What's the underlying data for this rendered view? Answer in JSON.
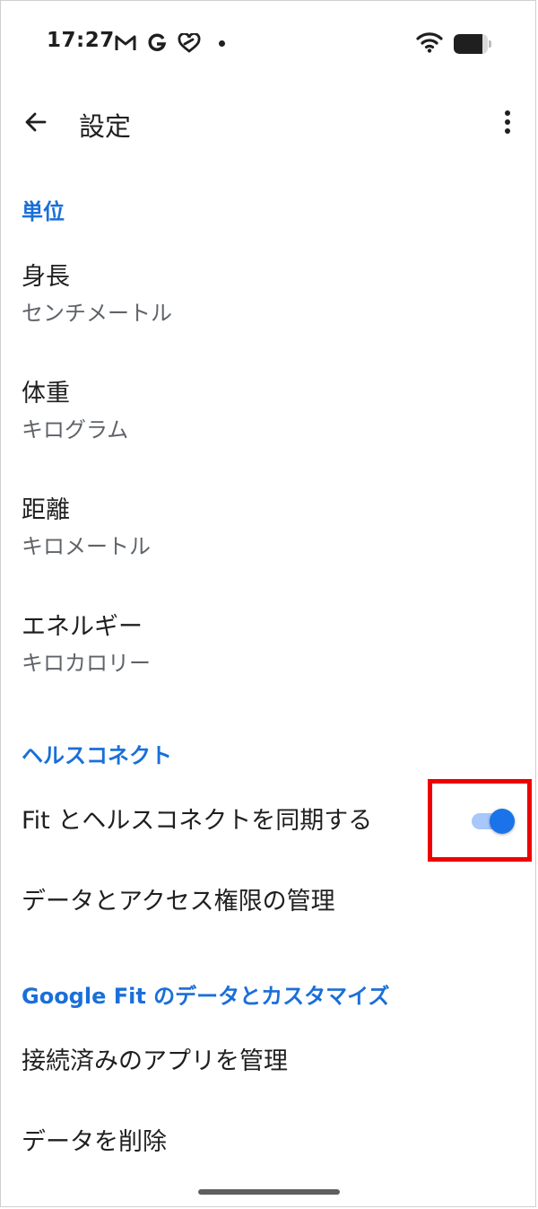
{
  "status_bar": {
    "time": "17:27",
    "notification_icons": [
      "gmail-icon",
      "google-icon",
      "heart-link-icon",
      "notification-dot"
    ],
    "wifi_icon": "wifi-icon",
    "battery_level": 0.85
  },
  "app_bar": {
    "back_icon": "arrow-back-icon",
    "title": "設定",
    "more_icon": "more-vert-icon"
  },
  "sections": {
    "units": {
      "header": "単位",
      "height": {
        "title": "身長",
        "value": "センチメートル"
      },
      "weight": {
        "title": "体重",
        "value": "キログラム"
      },
      "distance": {
        "title": "距離",
        "value": "キロメートル"
      },
      "energy": {
        "title": "エネルギー",
        "value": "キロカロリー"
      }
    },
    "health_connect": {
      "header": "ヘルスコネクト",
      "sync": {
        "title": "Fit とヘルスコネクトを同期する",
        "enabled": true
      },
      "manage_data": {
        "title": "データとアクセス権限の管理"
      }
    },
    "google_fit": {
      "header": "Google Fit のデータとカスタマイズ",
      "connected_apps": {
        "title": "接続済みのアプリを管理"
      },
      "delete_data": {
        "title": "データを削除"
      }
    }
  },
  "colors": {
    "accent": "#1a6fd8",
    "toggle_thumb": "#1a73e8",
    "toggle_track": "#a8c7fa",
    "highlight": "#ee0000",
    "text_primary": "#1f1f1f",
    "text_secondary": "#5f6368"
  }
}
